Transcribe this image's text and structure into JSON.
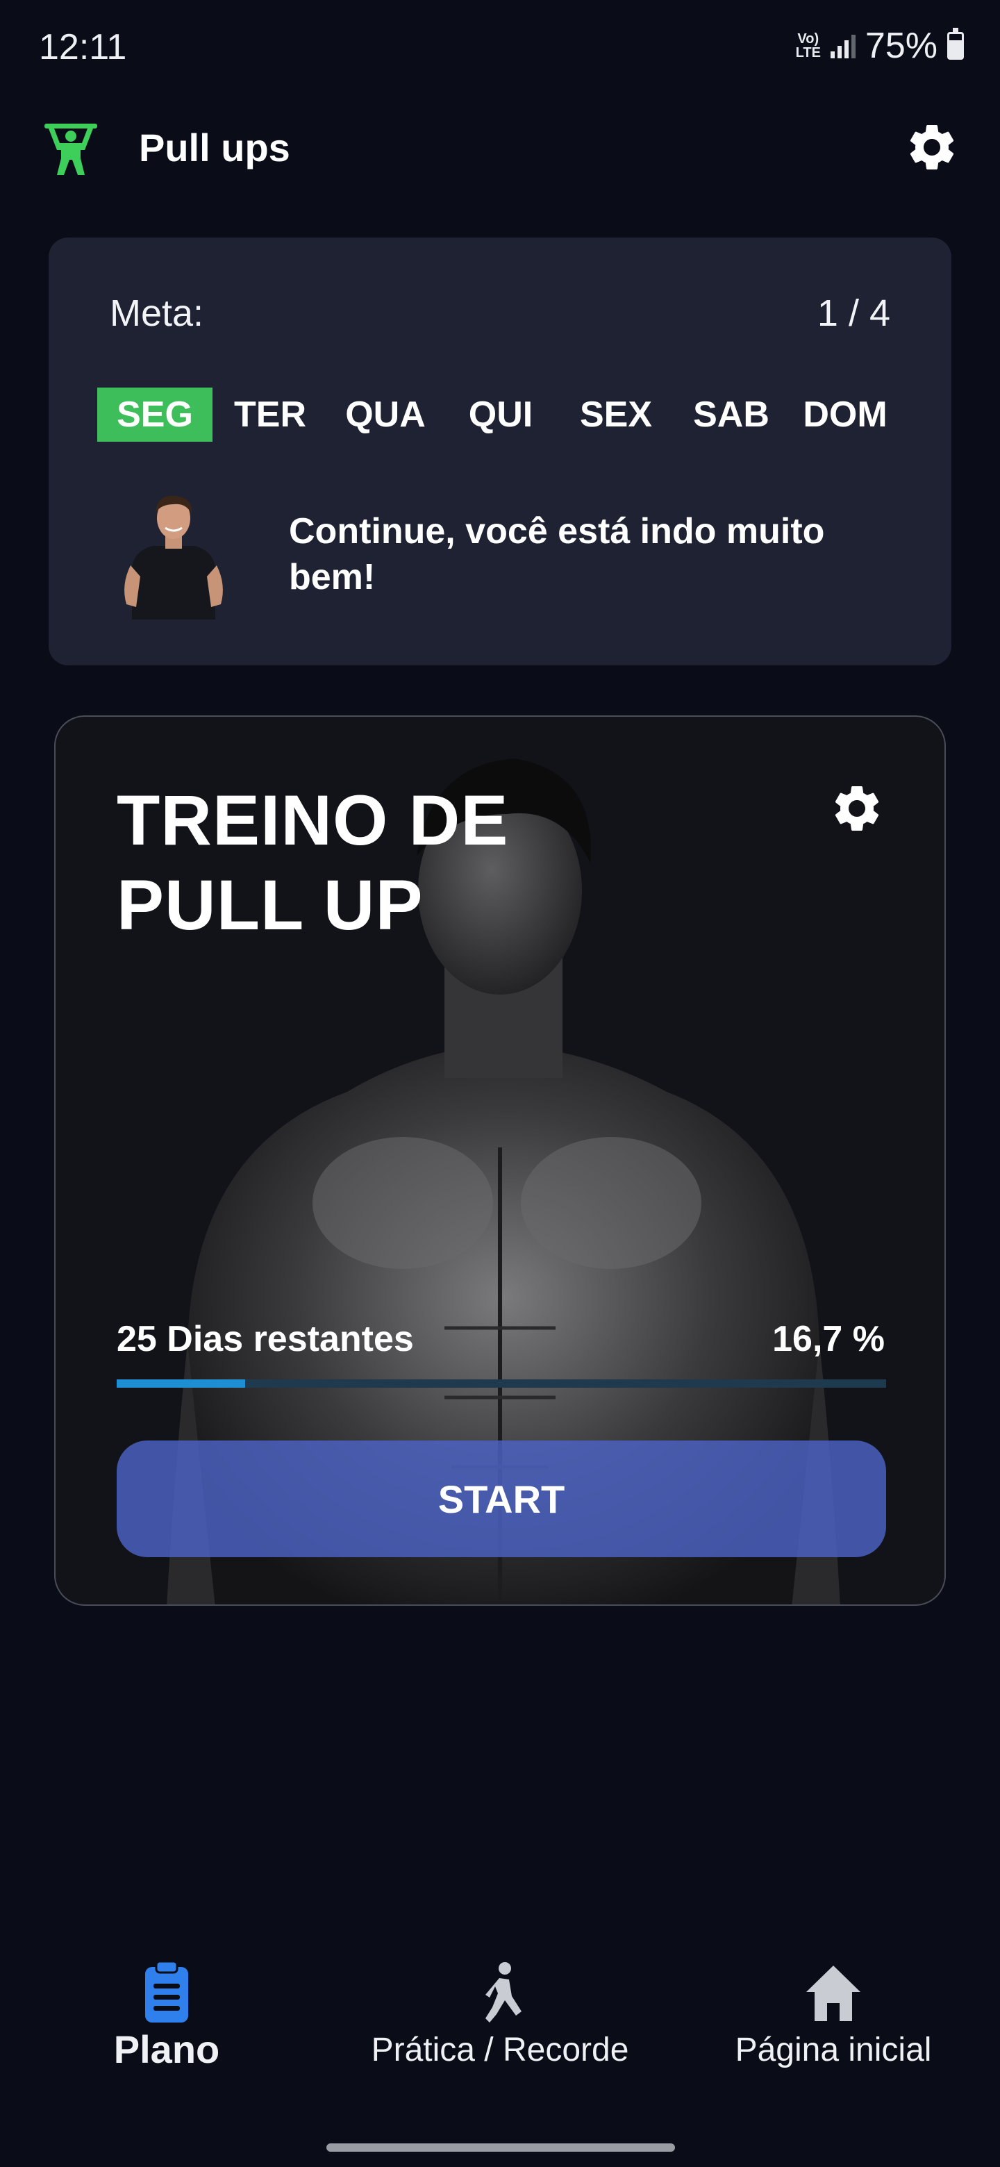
{
  "status_bar": {
    "time": "12:11",
    "network_top": "Vo)",
    "network_bottom": "LTE",
    "battery": "75%"
  },
  "app_bar": {
    "title": "Pull ups",
    "logo_icon": "pullup-figure-icon",
    "settings_icon": "gear-icon"
  },
  "goal": {
    "label": "Meta:",
    "count": "1 / 4",
    "days": [
      "SEG",
      "TER",
      "QUA",
      "QUI",
      "SEX",
      "SAB",
      "DOM"
    ],
    "active_day": "SEG",
    "motivation": "Continue, você está indo muito bem!"
  },
  "workout": {
    "title_line1": "TREINO DE",
    "title_line2": "PULL UP",
    "days_remaining": "25 Dias restantes",
    "percent": "16,7 %",
    "progress": 0.167,
    "start_label": "START"
  },
  "nav": {
    "items": [
      {
        "label": "Plano",
        "icon": "clipboard-icon",
        "active": true
      },
      {
        "label": "Prática / Recorde",
        "icon": "running-figure-icon",
        "active": false
      },
      {
        "label": "Página inicial",
        "icon": "home-icon",
        "active": false
      }
    ]
  },
  "colors": {
    "background": "#0a0d17",
    "card": "#1e2232",
    "active_day": "#3ebd5b",
    "progress": "#1f8fd4",
    "start_button": "#4c63c4",
    "nav_active": "#2f80ed",
    "logo": "#3ecf5a"
  }
}
